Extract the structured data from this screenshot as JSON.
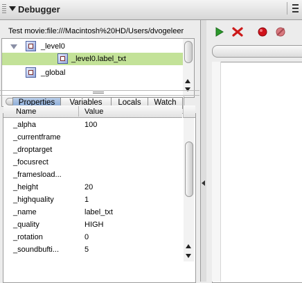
{
  "panel": {
    "title": "Debugger",
    "movie_label": "Test movie:file:///Macintosh%20HD/Users/dvogeleer"
  },
  "tree": {
    "items": [
      {
        "label": "_level0",
        "icon": "movieclip-icon",
        "expanded": true,
        "selected": false
      },
      {
        "label": "_level0.label_txt",
        "icon": "movieclip-icon",
        "selected": true
      },
      {
        "label": "_global",
        "icon": "movieclip-icon",
        "selected": false
      }
    ]
  },
  "tabs": [
    {
      "label": "Properties",
      "active": true
    },
    {
      "label": "Variables",
      "active": false
    },
    {
      "label": "Locals",
      "active": false
    },
    {
      "label": "Watch",
      "active": false
    }
  ],
  "properties": {
    "columns": [
      "Name",
      "Value"
    ],
    "rows": [
      {
        "name": "_alpha",
        "value": "100"
      },
      {
        "name": "_currentframe",
        "value": ""
      },
      {
        "name": "_droptarget",
        "value": ""
      },
      {
        "name": "_focusrect",
        "value": ""
      },
      {
        "name": "_framesload...",
        "value": ""
      },
      {
        "name": "_height",
        "value": "20"
      },
      {
        "name": "_highquality",
        "value": "1"
      },
      {
        "name": "_name",
        "value": "label_txt"
      },
      {
        "name": "_quality",
        "value": "HIGH"
      },
      {
        "name": "_rotation",
        "value": "0"
      },
      {
        "name": "_soundbufti...",
        "value": "5"
      }
    ]
  },
  "toolbar": {
    "icons": [
      "continue-icon",
      "stop-debugging-icon",
      "toggle-breakpoint-icon",
      "remove-all-breakpoints-icon"
    ]
  },
  "colors": {
    "selection": "#c3e298",
    "tab_active": "#8fb0dc",
    "continue_green": "#2c9a2c",
    "stop_red": "#cc1a1a",
    "breakpoint_red": "#d0121b"
  }
}
